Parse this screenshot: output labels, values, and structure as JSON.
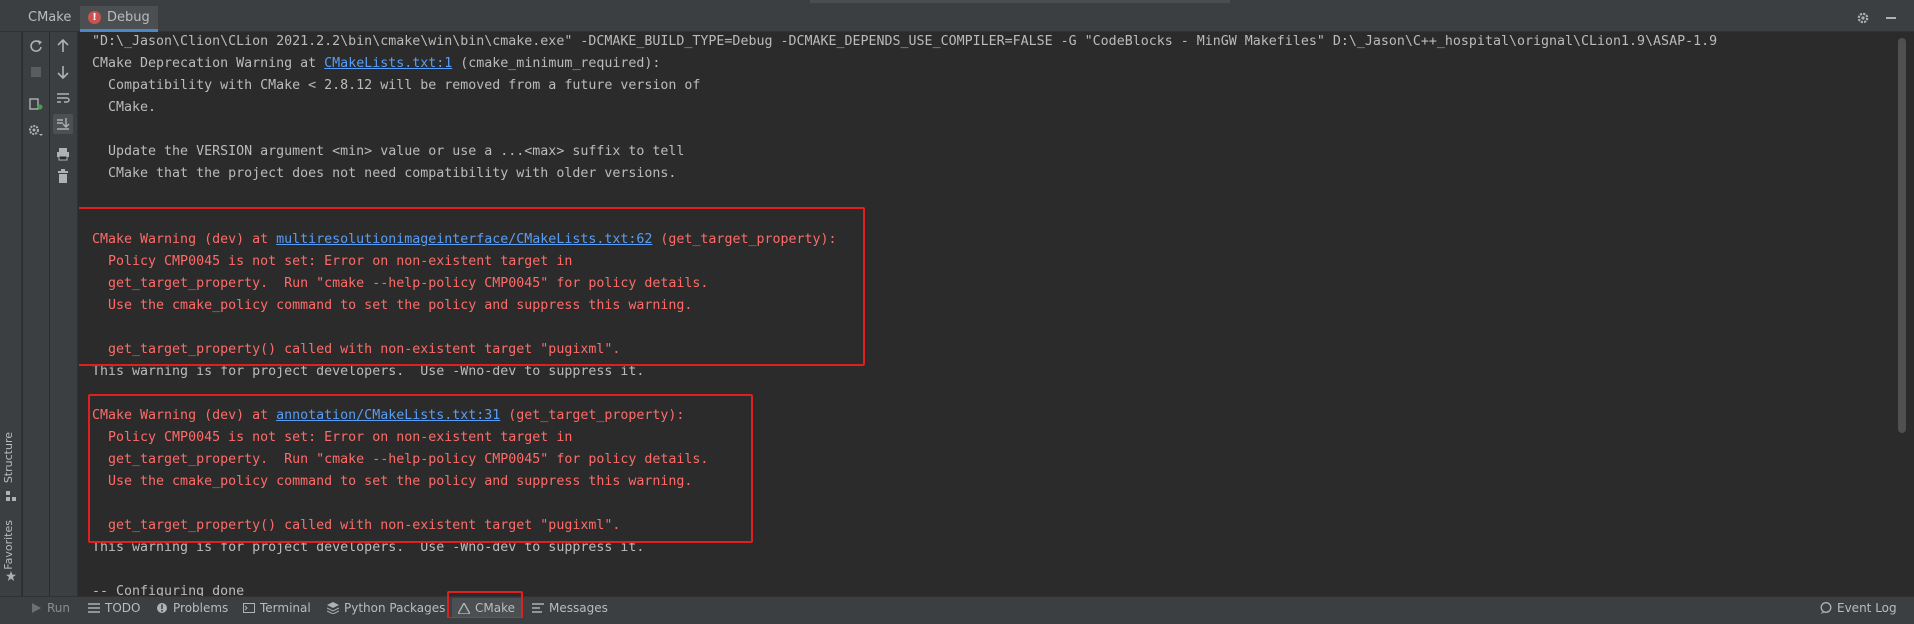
{
  "header": {
    "title": "CMake",
    "tab_label": "Debug",
    "error_glyph": "!"
  },
  "left_tabs": {
    "structure": "Structure",
    "favorites": "Favorites"
  },
  "console": {
    "line1": "\"D:\\_Jason\\Clion\\CLion 2021.2.2\\bin\\cmake\\win\\bin\\cmake.exe\" -DCMAKE_BUILD_TYPE=Debug -DCMAKE_DEPENDS_USE_COMPILER=FALSE -G \"CodeBlocks - MinGW Makefiles\" D:\\_Jason\\C++_hospital\\orignal\\CLion1.9\\ASAP-1.9",
    "dep_prefix": "CMake Deprecation Warning at ",
    "dep_link": "CMakeLists.txt:1",
    "dep_suffix": " (cmake_minimum_required):",
    "line3": "  Compatibility with CMake < 2.8.12 will be removed from a future version of",
    "line4": "  CMake.",
    "line6": "  Update the VERSION argument <min> value or use a ...<max> suffix to tell",
    "line7": "  CMake that the project does not need compatibility with older versions.",
    "w1_prefix": "CMake Warning (dev) at ",
    "w1_link": "multiresolutionimageinterface/CMakeLists.txt:62",
    "w1_suffix": " (get_target_property):",
    "w1_l2": "  Policy CMP0045 is not set: Error on non-existent target in",
    "w1_l3": "  get_target_property.  Run \"cmake --help-policy CMP0045\" for policy details.",
    "w1_l4": "  Use the cmake_policy command to set the policy and suppress this warning.",
    "w1_l6": "  get_target_property() called with non-existent target \"pugixml\".",
    "w1_tail": "This warning is for project developers.  Use -Wno-dev to suppress it.",
    "w2_prefix": "CMake Warning (dev) at ",
    "w2_link": "annotation/CMakeLists.txt:31",
    "w2_suffix": " (get_target_property):",
    "w2_l2": "  Policy CMP0045 is not set: Error on non-existent target in",
    "w2_l3": "  get_target_property.  Run \"cmake --help-policy CMP0045\" for policy details.",
    "w2_l4": "  Use the cmake_policy command to set the policy and suppress this warning.",
    "w2_l6": "  get_target_property() called with non-existent target \"pugixml\".",
    "w2_tail": "This warning is for project developers.  Use -Wno-dev to suppress it.",
    "configuring": "-- Configuring done"
  },
  "bottom_tabs": {
    "run": "Run",
    "todo": "TODO",
    "problems": "Problems",
    "terminal": "Terminal",
    "python_packages": "Python Packages",
    "cmake": "CMake",
    "messages": "Messages",
    "event_log": "Event Log"
  },
  "colors": {
    "background": "#2b2b2b",
    "panel": "#3c3f41",
    "warning_text": "#ff6b68",
    "link": "#589df6",
    "highlight_box": "#e02020"
  }
}
